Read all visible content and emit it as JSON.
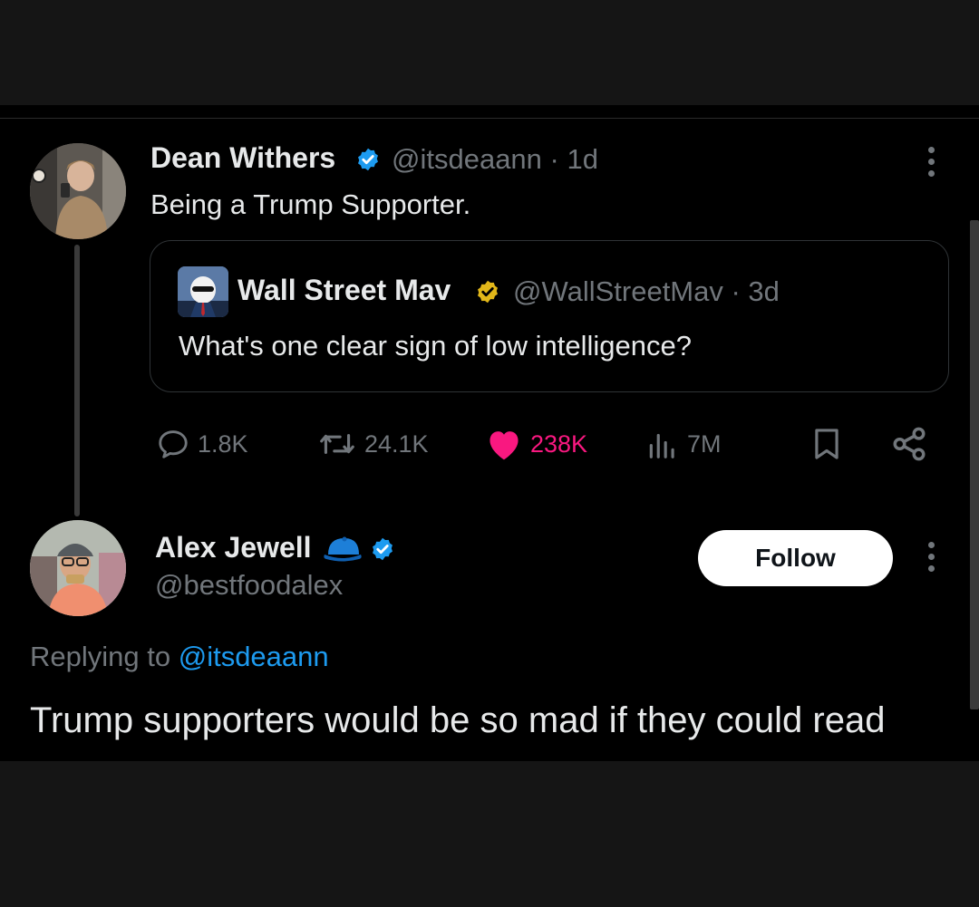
{
  "colors": {
    "background": "#000000",
    "outer": "#151515",
    "text": "#e7e9ea",
    "muted": "#71767b",
    "accent": "#1d9bf0",
    "like": "#f91880",
    "verified_blue": "#1d9bf0",
    "verified_gold": "#e2b719"
  },
  "main_post": {
    "author_name": "Dean Withers",
    "handle_time": "@itsdeaann · 1d",
    "text": "Being a Trump Supporter.",
    "verified_icon": "verified-badge-blue",
    "more_icon": "more-vertical-icon"
  },
  "quoted_post": {
    "author_name": "Wall Street Mav",
    "handle_time": "@WallStreetMav · 3d",
    "text": "What's one clear sign of low intelligence?",
    "verified_icon": "verified-badge-gold"
  },
  "actions": {
    "replies": "1.8K",
    "reposts": "24.1K",
    "likes": "238K",
    "views": "7M",
    "liked": true
  },
  "reply_post": {
    "author_name": "Alex Jewell",
    "handle": "@bestfoodalex",
    "follow_label": "Follow",
    "affiliation_icon": "blue-cap-emoji",
    "verified_icon": "verified-badge-blue",
    "replying_prefix": "Replying to",
    "replying_to": "@itsdeaann",
    "text": "Trump supporters would be so mad if they could read"
  }
}
